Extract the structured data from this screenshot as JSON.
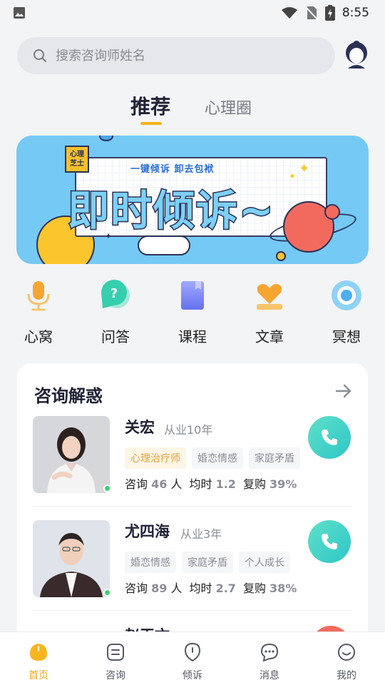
{
  "status_bar": {
    "time": "8:55"
  },
  "search": {
    "placeholder": "搜索咨询师姓名"
  },
  "tabs": [
    {
      "label": "推荐",
      "active": true
    },
    {
      "label": "心理圈",
      "active": false
    }
  ],
  "banner": {
    "tag_text": "心理 芝士",
    "subtitle": "一键倾诉 卸去包袱",
    "headline": "即时倾诉~"
  },
  "quick_nav": [
    {
      "label": "心窝",
      "icon": "microphone-icon"
    },
    {
      "label": "问答",
      "icon": "question-bubble-icon"
    },
    {
      "label": "课程",
      "icon": "book-icon"
    },
    {
      "label": "文章",
      "icon": "heart-article-icon"
    },
    {
      "label": "冥想",
      "icon": "meditation-circle-icon"
    }
  ],
  "consult": {
    "title": "咨询解惑",
    "counselors": [
      {
        "name": "关宏",
        "years": "从业10年",
        "tags": [
          "心理治疗师",
          "婚恋情感",
          "家庭矛盾"
        ],
        "stat_consult_label": "咨询",
        "stat_consult_value": "46",
        "stat_consult_unit": "人",
        "stat_hours_label": "均时",
        "stat_hours_value": "1.2",
        "stat_repurchase_label": "复购",
        "stat_repurchase_value": "39%",
        "online": true
      },
      {
        "name": "尤四海",
        "years": "从业3年",
        "tags": [
          "婚恋情感",
          "家庭矛盾",
          "个人成长"
        ],
        "stat_consult_label": "咨询",
        "stat_consult_value": "89",
        "stat_consult_unit": "人",
        "stat_hours_label": "均时",
        "stat_hours_value": "2.7",
        "stat_repurchase_label": "复购",
        "stat_repurchase_value": "38%",
        "online": true
      },
      {
        "name": "赵玉文",
        "partial": true
      }
    ]
  },
  "bottom_nav": [
    {
      "label": "首页",
      "active": true
    },
    {
      "label": "咨询",
      "active": false
    },
    {
      "label": "倾诉",
      "active": false
    },
    {
      "label": "消息",
      "active": false
    },
    {
      "label": "我的",
      "active": false
    }
  ],
  "colors": {
    "accent": "#f0a81c",
    "call_button": "#2ec6c9",
    "banner_bg": "#75c9f5"
  }
}
